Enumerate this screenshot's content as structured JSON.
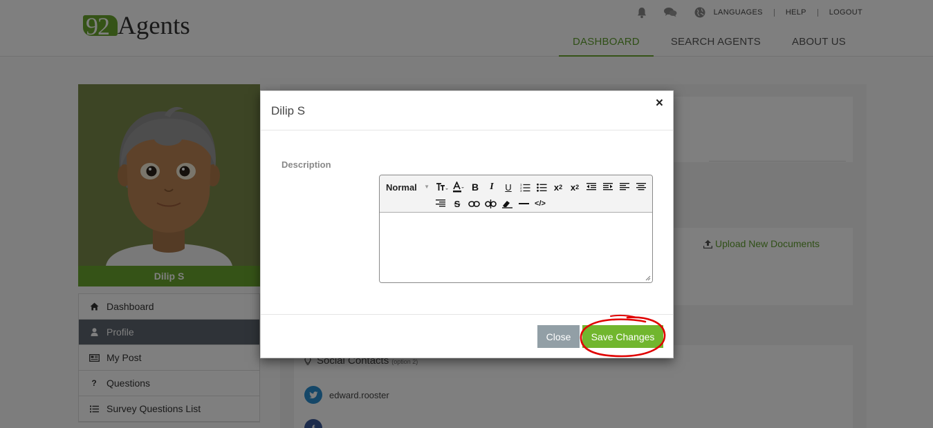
{
  "brand": {
    "logo_number": "92",
    "logo_word": "Agents",
    "accent": "#6aa72e"
  },
  "topbar": {
    "icons": [
      "bell-icon",
      "chat-icon",
      "globe-icon"
    ],
    "languages": "LANGUAGES",
    "help": "HELP",
    "logout": "LOGOUT"
  },
  "nav": {
    "items": [
      {
        "label": "DASHBOARD",
        "active": true
      },
      {
        "label": "SEARCH AGENTS",
        "active": false
      },
      {
        "label": "ABOUT US",
        "active": false
      }
    ]
  },
  "profile": {
    "name": "Dilip S"
  },
  "sidebar": {
    "items": [
      {
        "label": "Dashboard",
        "icon": "home-icon",
        "active": false
      },
      {
        "label": "Profile",
        "icon": "user-icon",
        "active": true
      },
      {
        "label": "My Post",
        "icon": "newspaper-icon",
        "active": false
      },
      {
        "label": "Questions",
        "icon": "question-icon",
        "active": false
      },
      {
        "label": "Survey Questions List",
        "icon": "list-icon",
        "active": false
      }
    ]
  },
  "documents": {
    "upload_label": "Upload New Documents"
  },
  "social": {
    "title": "Social Contacts",
    "subtitle": "(option 2)",
    "contacts": [
      {
        "network": "twitter",
        "handle": "edward.rooster"
      }
    ]
  },
  "modal": {
    "title": "Dilip S",
    "close_symbol": "×",
    "description_label": "Description",
    "editor": {
      "style_value": "Normal",
      "toolbar_row1": [
        "font-size",
        "font-color",
        "bold",
        "italic",
        "underline",
        "ordered-list",
        "unordered-list",
        "subscript",
        "superscript",
        "outdent",
        "indent",
        "align-left",
        "align-center"
      ],
      "toolbar_row2": [
        "align-right",
        "strikethrough",
        "insert-link",
        "unlink",
        "clear-formatting",
        "horizontal-rule",
        "code-view"
      ],
      "content": ""
    },
    "buttons": {
      "close": "Close",
      "save": "Save Changes"
    }
  },
  "colors": {
    "save_button": "#71b62e",
    "close_button": "#929fa6",
    "annotation": "#e00000"
  }
}
